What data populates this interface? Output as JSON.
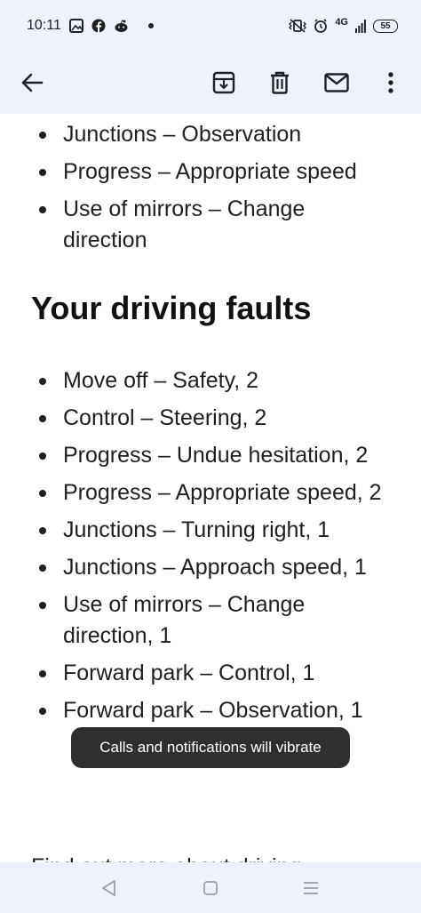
{
  "status_bar": {
    "time": "10:11",
    "network": "4G",
    "battery": "55",
    "icons": [
      "photos-icon",
      "facebook-icon",
      "reddit-icon",
      "dot-icon",
      "vibrate-icon",
      "alarm-icon",
      "signal-icon",
      "battery-icon"
    ]
  },
  "toolbar": {
    "icons": [
      "back-arrow-icon",
      "archive-icon",
      "delete-icon",
      "mark-unread-icon",
      "more-vert-icon"
    ]
  },
  "email": {
    "list_top": [
      "Junctions – Observation",
      "Progress – Appropriate speed",
      "Use of mirrors – Change direction"
    ],
    "heading": "Your driving faults",
    "faults": [
      "Move off – Safety, 2",
      "Control – Steering, 2",
      "Progress – Undue hesitation, 2",
      "Progress – Appropriate speed, 2",
      "Junctions – Turning right, 1",
      "Junctions – Approach speed, 1",
      "Use of mirrors – Change direction, 1",
      "Forward park – Control, 1",
      "Forward park – Observation, 1"
    ],
    "cut_off_text": "Find out more about driving"
  },
  "toast": {
    "message": "Calls and notifications will vibrate"
  },
  "nav_bar": {
    "icons": [
      "back-triangle-icon",
      "home-square-icon",
      "recents-lines-icon"
    ]
  },
  "colors": {
    "chrome_background": "#eef2fb",
    "text": "#1f1f1f",
    "toast_background": "#2f2f2f"
  }
}
